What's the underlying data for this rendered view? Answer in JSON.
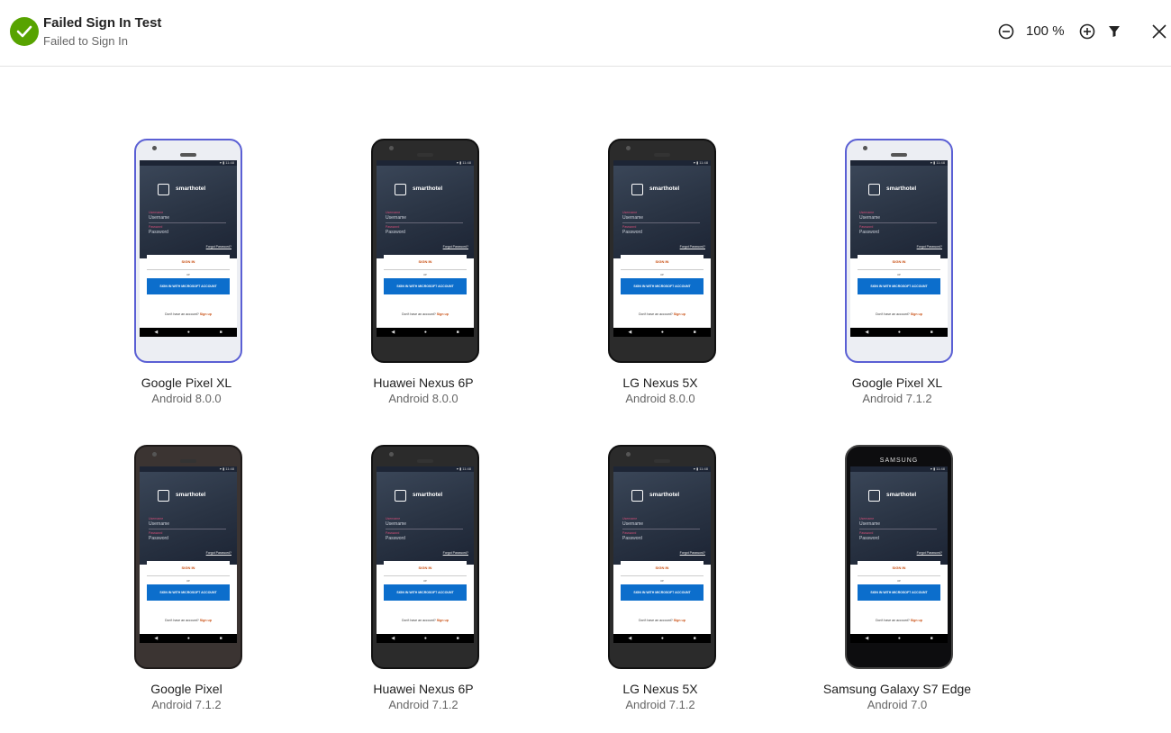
{
  "header": {
    "title": "Failed Sign In Test",
    "subtitle": "Failed to Sign In",
    "status_icon": "checkmark-circle-icon",
    "status_color": "#57a300",
    "zoom_value": "100 %",
    "icons": {
      "zoom_out": "zoom-out-icon",
      "zoom_in": "zoom-in-icon",
      "filter": "filter-icon",
      "close": "close-icon"
    }
  },
  "app_screen": {
    "logo_text": "smarthotel",
    "username_label": "Username",
    "password_label": "Password",
    "forgot_password": "Forgot Password?",
    "sign_in": "SIGN IN",
    "or": "or",
    "microsoft_sign_in": "SIGN IN WITH MICROSOFT ACCOUNT",
    "no_account": "Don't have an account?",
    "sign_up": "Sign up"
  },
  "devices": [
    {
      "name": "Google Pixel XL",
      "os": "Android 8.0.0",
      "style": "light"
    },
    {
      "name": "Huawei Nexus 6P",
      "os": "Android 8.0.0",
      "style": "dark"
    },
    {
      "name": "LG Nexus 5X",
      "os": "Android 8.0.0",
      "style": "dark"
    },
    {
      "name": "Google Pixel XL",
      "os": "Android 7.1.2",
      "style": "light"
    },
    {
      "name": "Google Pixel",
      "os": "Android 7.1.2",
      "style": "brown"
    },
    {
      "name": "Huawei Nexus 6P",
      "os": "Android 7.1.2",
      "style": "dark"
    },
    {
      "name": "LG Nexus 5X",
      "os": "Android 7.1.2",
      "style": "dark"
    },
    {
      "name": "Samsung Galaxy S7 Edge",
      "os": "Android 7.0",
      "style": "samsung",
      "brand": "SAMSUNG"
    }
  ]
}
